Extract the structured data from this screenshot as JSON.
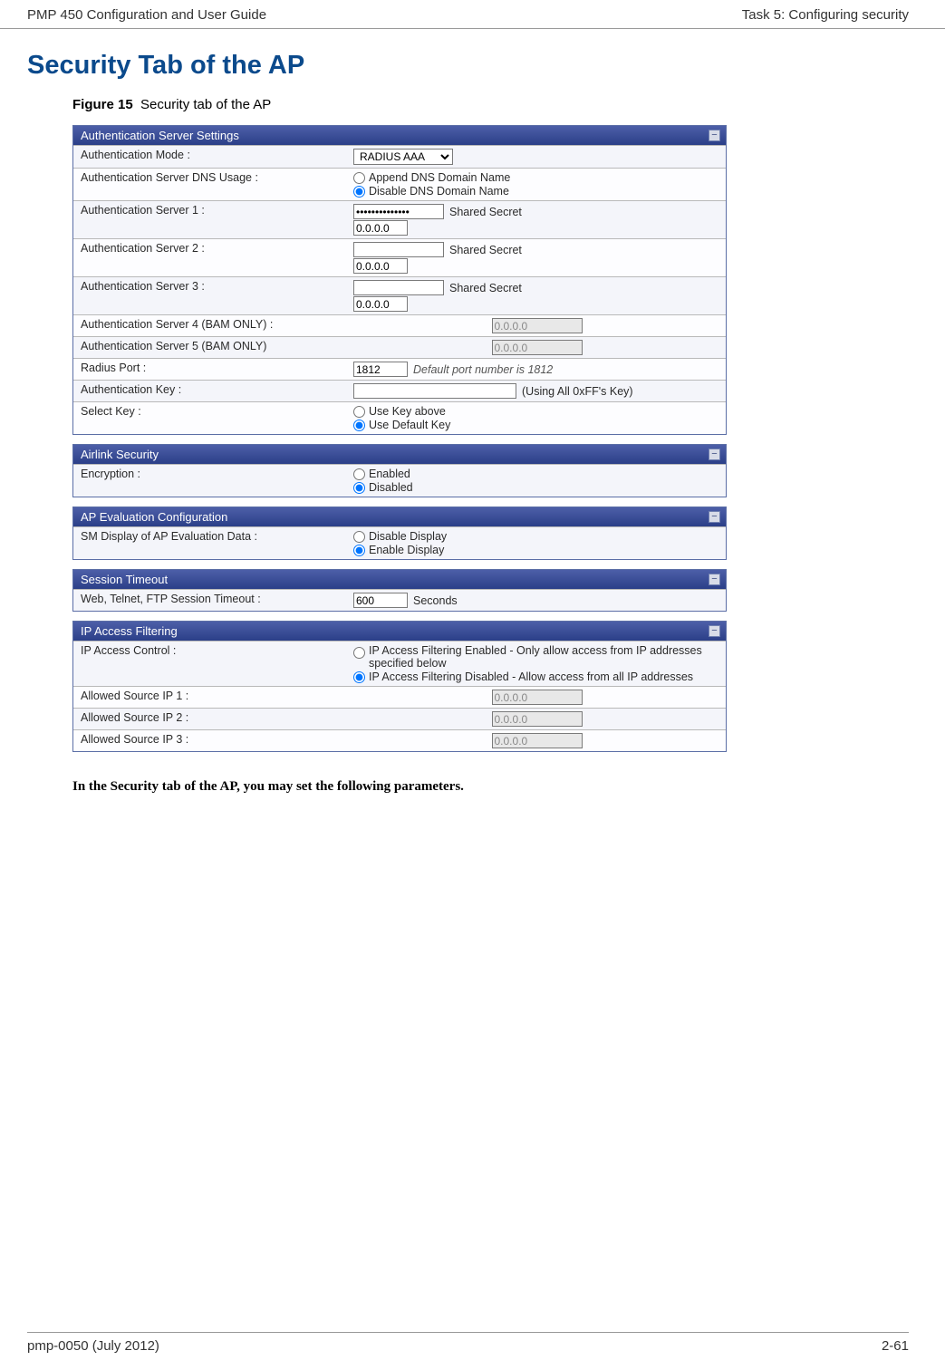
{
  "header": {
    "left": "PMP 450 Configuration and User Guide",
    "right": "Task 5: Configuring security"
  },
  "title": "Security Tab of the AP",
  "figure": {
    "label": "Figure 15",
    "caption": "Security tab of the AP"
  },
  "panels": {
    "auth": {
      "title": "Authentication Server Settings",
      "rows": {
        "mode_label": "Authentication Mode :",
        "mode_value": "RADIUS AAA",
        "dns_label": "Authentication Server DNS Usage :",
        "dns_opt1": "Append DNS Domain Name",
        "dns_opt2": "Disable DNS Domain Name",
        "s1_label": "Authentication Server 1 :",
        "s2_label": "Authentication Server 2 :",
        "s3_label": "Authentication Server 3 :",
        "shared_secret": "Shared Secret",
        "secret_mask": "••••••••••••••",
        "ip_default": "0.0.0.0",
        "s4_label": "Authentication Server 4 (BAM ONLY) :",
        "s5_label": "Authentication Server 5 (BAM ONLY)",
        "radius_port_label": "Radius Port :",
        "radius_port_value": "1812",
        "radius_port_note": "Default port number is 1812",
        "authkey_label": "Authentication Key :",
        "authkey_note": "(Using All 0xFF's Key)",
        "selectkey_label": "Select Key :",
        "selectkey_opt1": "Use Key above",
        "selectkey_opt2": "Use Default Key"
      }
    },
    "airlink": {
      "title": "Airlink Security",
      "enc_label": "Encryption :",
      "enc_opt1": "Enabled",
      "enc_opt2": "Disabled"
    },
    "apeval": {
      "title": "AP Evaluation Configuration",
      "label": "SM Display of AP Evaluation Data :",
      "opt1": "Disable Display",
      "opt2": "Enable Display"
    },
    "session": {
      "title": "Session Timeout",
      "label": "Web, Telnet, FTP Session Timeout :",
      "value": "600",
      "unit": "Seconds"
    },
    "ipfilter": {
      "title": "IP Access Filtering",
      "ctrl_label": "IP Access Control :",
      "opt1": "IP Access Filtering Enabled - Only allow access from IP addresses specified below",
      "opt2": "IP Access Filtering Disabled - Allow access from all IP addresses",
      "src1_label": "Allowed Source IP 1 :",
      "src2_label": "Allowed Source IP 2 :",
      "src3_label": "Allowed Source IP 3 :",
      "ip_default": "0.0.0.0"
    }
  },
  "body_text": "In the Security tab of the AP, you may set the following parameters.",
  "footer": {
    "left": "pmp-0050 (July 2012)",
    "right": "2-61"
  }
}
